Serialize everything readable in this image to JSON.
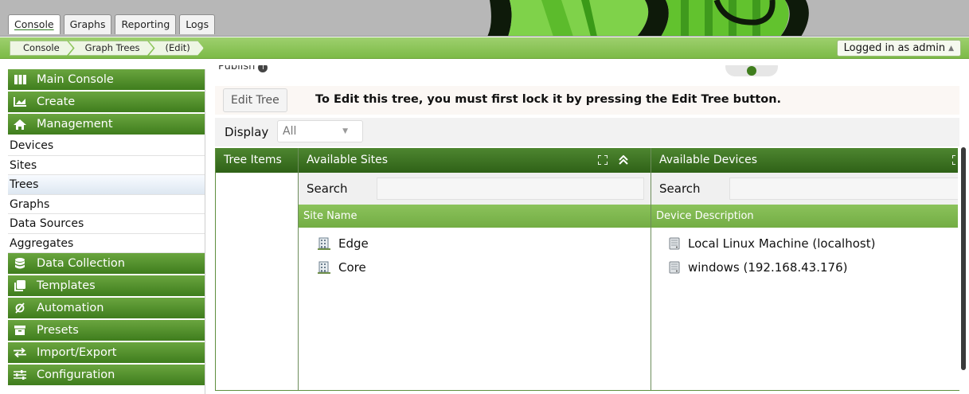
{
  "tabs": [
    {
      "label": "Console"
    },
    {
      "label": "Graphs"
    },
    {
      "label": "Reporting"
    },
    {
      "label": "Logs"
    }
  ],
  "breadcrumb": [
    {
      "label": "Console"
    },
    {
      "label": "Graph Trees"
    },
    {
      "label": "(Edit)"
    }
  ],
  "user": {
    "label": "Logged in as admin"
  },
  "sidebar": {
    "sections": [
      {
        "label": "Main Console",
        "icon": "columns-icon"
      },
      {
        "label": "Create",
        "icon": "chart-icon"
      },
      {
        "label": "Management",
        "icon": "home-icon"
      },
      {
        "label": "Data Collection",
        "icon": "database-icon"
      },
      {
        "label": "Templates",
        "icon": "clone-icon"
      },
      {
        "label": "Automation",
        "icon": "empty-set-icon"
      },
      {
        "label": "Presets",
        "icon": "archive-icon"
      },
      {
        "label": "Import/Export",
        "icon": "exchange-icon"
      },
      {
        "label": "Configuration",
        "icon": "sliders-icon"
      }
    ],
    "management_items": [
      {
        "label": "Devices"
      },
      {
        "label": "Sites"
      },
      {
        "label": "Trees",
        "active": true
      },
      {
        "label": "Graphs"
      },
      {
        "label": "Data Sources"
      },
      {
        "label": "Aggregates"
      }
    ]
  },
  "publish": {
    "label": "Publish"
  },
  "edit": {
    "button": "Edit Tree",
    "message": "To Edit this tree, you must first lock it by pressing the Edit Tree button."
  },
  "display": {
    "label": "Display",
    "value": "All"
  },
  "tree": {
    "tree_items_header": "Tree Items",
    "sites": {
      "header": "Available Sites",
      "search_label": "Search",
      "column": "Site Name",
      "items": [
        "Edge",
        "Core"
      ]
    },
    "devices": {
      "header": "Available Devices",
      "search_label": "Search",
      "column": "Device Description",
      "items": [
        "Local Linux Machine (localhost)",
        "windows (192.168.43.176)"
      ]
    }
  },
  "colors": {
    "header_green": "#3f7d1d",
    "light_green": "#7cba47",
    "banner_green": "#5fbf2a"
  }
}
